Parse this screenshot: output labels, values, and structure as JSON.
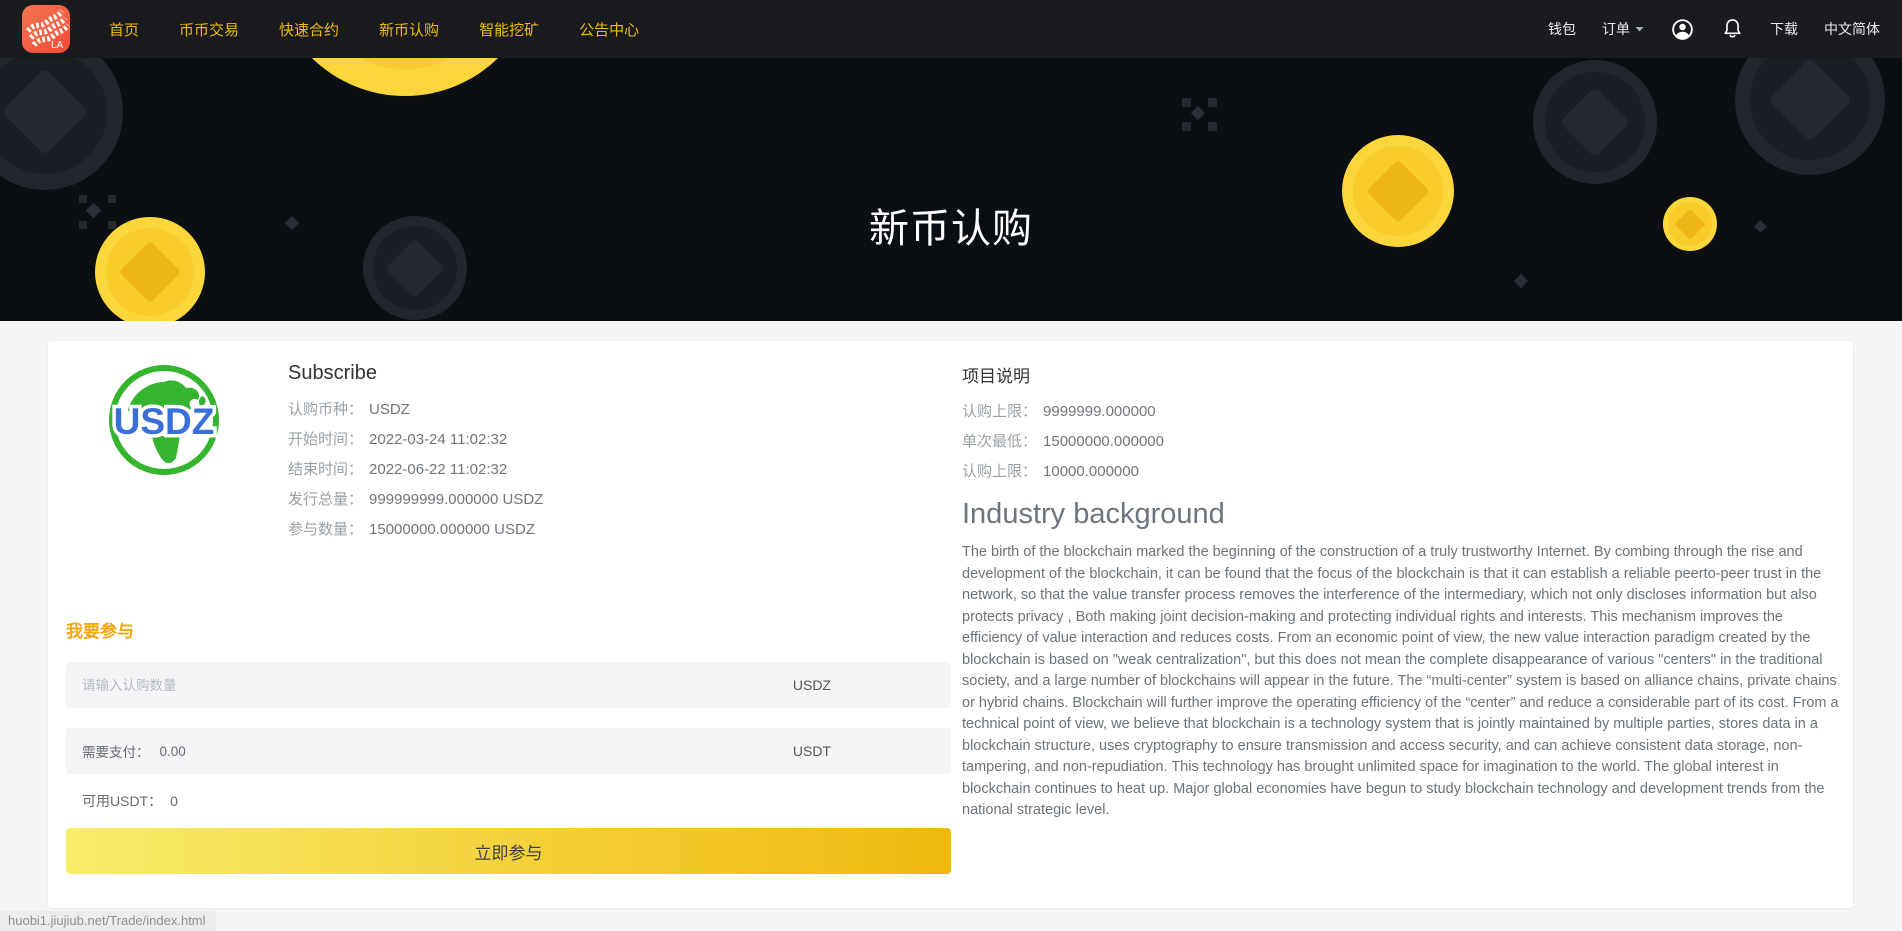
{
  "nav": {
    "logo_text": "LA",
    "items": [
      {
        "label": "首页"
      },
      {
        "label": "币币交易"
      },
      {
        "label": "快速合约"
      },
      {
        "label": "新币认购"
      },
      {
        "label": "智能挖矿"
      },
      {
        "label": "公告中心"
      }
    ],
    "right": {
      "wallet": "钱包",
      "orders": "订单",
      "download": "下载",
      "language": "中文简体"
    }
  },
  "hero": {
    "title": "新币认购"
  },
  "subscribe": {
    "heading": "Subscribe",
    "logo_text": "USDZ",
    "fields": [
      {
        "label": "认购币种：",
        "value": "USDZ"
      },
      {
        "label": "开始时间：",
        "value": "2022-03-24 11:02:32"
      },
      {
        "label": "结束时间：",
        "value": "2022-06-22 11:02:32"
      },
      {
        "label": "发行总量：",
        "value": "999999999.000000 USDZ"
      },
      {
        "label": "参与数量：",
        "value": "15000000.000000 USDZ"
      }
    ]
  },
  "participate": {
    "heading": "我要参与",
    "amount_placeholder": "请输入认购数量",
    "amount_unit": "USDZ",
    "pay_label": "需要支付：",
    "pay_value": "0.00",
    "pay_unit": "USDT",
    "available_label": "可用USDT：",
    "available_value": "0",
    "button_label": "立即参与"
  },
  "project": {
    "heading": "项目说明",
    "fields": [
      {
        "label": "认购上限：",
        "value": "9999999.000000"
      },
      {
        "label": "单次最低：",
        "value": "15000000.000000"
      },
      {
        "label": "认购上限：",
        "value": "10000.000000"
      }
    ],
    "article_title": "Industry background",
    "article_body": "The birth of the blockchain marked the beginning of the construction of a truly trustworthy Internet. By combing through the rise and development of the blockchain, it can be found that the focus of the blockchain is that it can establish a reliable peerto-peer trust in the network, so that the value transfer process removes the interference of the intermediary, which not only discloses information but also protects privacy , Both making joint decision-making and protecting individual rights and interests. This mechanism improves the efficiency of value interaction and reduces costs. From an economic point of view, the new value interaction paradigm created by the blockchain is based on \"weak centralization\", but this does not mean the complete disappearance of various \"centers\" in the traditional society, and a large number of blockchains will appear in the future. The “multi-center” system is based on alliance chains, private chains or hybrid chains. Blockchain will further improve the operating efficiency of the “center” and reduce a considerable part of its cost. From a technical point of view, we believe that blockchain is a technology system that is jointly maintained by multiple parties, stores data in a blockchain structure, uses cryptography to ensure transmission and access security, and can achieve consistent data storage, non-tampering, and non-repudiation. This technology has brought unlimited space for imagination to the world. The global interest in blockchain continues to heat up. Major global economies have begun to study blockchain technology and development trends from the national strategic level."
  },
  "statusbar": {
    "url": "huobi1.jiujiub.net/Trade/index.html"
  },
  "colors": {
    "accent_yellow": "#f0b90b",
    "join_heading": "#f2a60d",
    "button_gradient_start": "#f9ec6a",
    "button_gradient_end": "#eeb80d",
    "coin_yellow": "#fcd73c",
    "banner_bg": "#0b0e12",
    "nav_bg": "#191b1f",
    "logo_red": "#ef4a38",
    "usdz_green": "#35b52f",
    "usdz_blue": "#3a6fd8"
  }
}
